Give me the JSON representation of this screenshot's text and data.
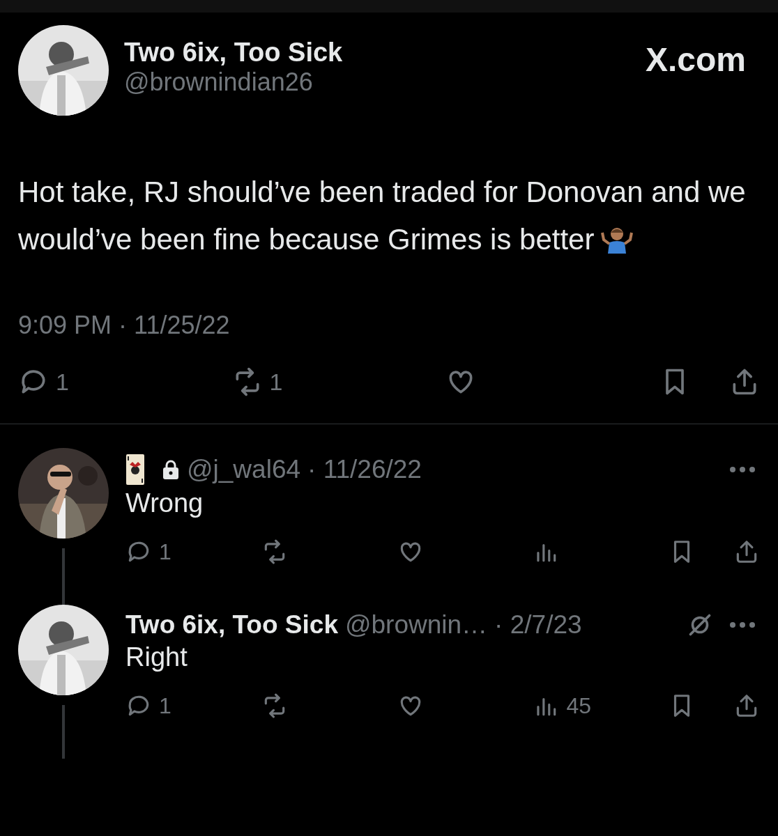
{
  "tweet": {
    "name": "Two 6ix, Too Sick",
    "handle": "@brownindian26",
    "brand": "X.com",
    "text": "Hot take, RJ should’ve been traded for Donovan and we would’ve been fine because Grimes is better",
    "timestamp": "9:09 PM · 11/25/22",
    "actions": [
      {
        "kind": "reply",
        "count": "1"
      },
      {
        "kind": "repost",
        "count": "1"
      },
      {
        "kind": "like"
      },
      {
        "kind": "bookmark"
      },
      {
        "kind": "share"
      }
    ]
  },
  "replies": [
    {
      "kind": "locked",
      "handle": "@j_wal64",
      "date": "· 11/26/22",
      "text": "Wrong",
      "actions": [
        {
          "kind": "reply",
          "count": "1"
        },
        {
          "kind": "repost"
        },
        {
          "kind": "like"
        },
        {
          "kind": "views"
        },
        {
          "kind": "bookmark"
        },
        {
          "kind": "share"
        }
      ]
    },
    {
      "kind": "named",
      "name": "Two 6ix, Too Sick",
      "handle": "@brownin…",
      "date": "· 2/7/23",
      "text": "Right",
      "actions": [
        {
          "kind": "reply",
          "count": "1"
        },
        {
          "kind": "repost"
        },
        {
          "kind": "like"
        },
        {
          "kind": "views",
          "count": "45"
        },
        {
          "kind": "bookmark"
        },
        {
          "kind": "share"
        }
      ]
    }
  ]
}
